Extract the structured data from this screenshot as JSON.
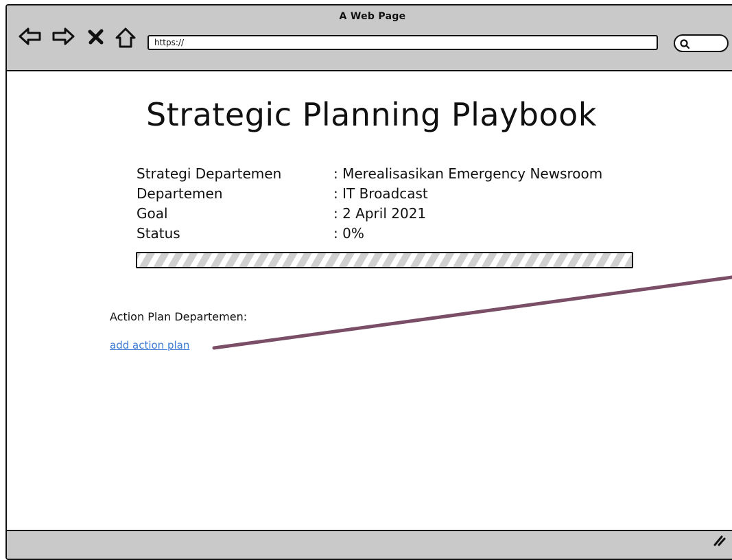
{
  "browser": {
    "window_title": "A Web Page",
    "url": "https://"
  },
  "page": {
    "title": "Strategic Planning Playbook",
    "info": [
      {
        "label": "Strategi Departemen",
        "value": ": Merealisasikan Emergency Newsroom"
      },
      {
        "label": "Departemen",
        "value": ": IT Broadcast"
      },
      {
        "label": "Goal",
        "value": ": 2 April 2021"
      },
      {
        "label": "Status",
        "value": ": 0%"
      }
    ],
    "progress_fraction": 0,
    "action_plan_label": "Action Plan Departemen:",
    "add_action_link": "add action plan"
  },
  "colors": {
    "link": "#3a7bd5",
    "connector": "#7a4e66",
    "chrome": "#c9c9c9"
  }
}
